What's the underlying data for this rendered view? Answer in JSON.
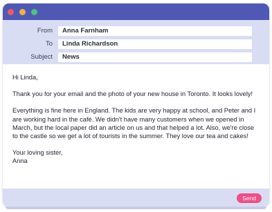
{
  "window": {
    "colors": {
      "titlebar": "#4f59b5",
      "header": "#d9ddf3",
      "send": "#ee4d86"
    },
    "controls": [
      "close-icon",
      "minimize-icon",
      "maximize-icon"
    ]
  },
  "header": {
    "from_label": "From",
    "from_value": "Anna Farnham",
    "to_label": "To",
    "to_value": "Linda Richardson",
    "subject_label": "Subject",
    "subject_value": "News"
  },
  "message": {
    "greeting": "Hi Linda,",
    "paragraph1": "Thank you for your email and the photo of your new house in Toronto. It looks lovely!",
    "paragraph2": "Everything is fine here in England. The kids are very happy at school, and Peter and I are working hard in the café. We didn't have many customers when we opened in March, but the local paper did an article on us and that helped a lot. Also, we're close to the castle so we get a lot of tourists in the summer. They love our tea and cakes!",
    "closing": "Your loving sister,",
    "signature": "Anna"
  },
  "footer": {
    "send_label": "Send"
  }
}
